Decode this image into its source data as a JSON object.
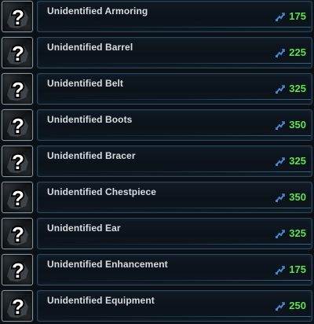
{
  "items": [
    {
      "name": "Unidentified Armoring",
      "cost": "175",
      "icon": "question-mark-armoring-icon"
    },
    {
      "name": "Unidentified Barrel",
      "cost": "225",
      "icon": "question-mark-barrel-icon"
    },
    {
      "name": "Unidentified Belt",
      "cost": "325",
      "icon": "question-mark-belt-icon"
    },
    {
      "name": "Unidentified Boots",
      "cost": "350",
      "icon": "question-mark-boots-icon"
    },
    {
      "name": "Unidentified Bracer",
      "cost": "325",
      "icon": "question-mark-bracer-icon"
    },
    {
      "name": "Unidentified Chestpiece",
      "cost": "350",
      "icon": "question-mark-chestpiece-icon"
    },
    {
      "name": "Unidentified Ear",
      "cost": "325",
      "icon": "question-mark-ear-icon"
    },
    {
      "name": "Unidentified Enhancement",
      "cost": "175",
      "icon": "question-mark-enhancement-icon"
    },
    {
      "name": "Unidentified Equipment",
      "cost": "250",
      "icon": "question-mark-equipment-icon"
    }
  ],
  "currency": {
    "icon": "commendation-icon",
    "value_color": "#5ee24e",
    "icon_color": "#4a86c8"
  }
}
